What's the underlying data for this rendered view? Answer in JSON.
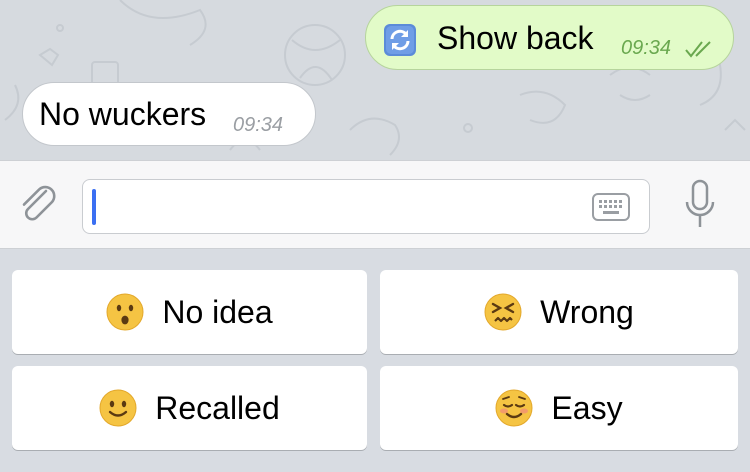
{
  "chat": {
    "messages": [
      {
        "direction": "outgoing",
        "icon": "reload-icon",
        "text": "Show back",
        "time": "09:34",
        "status": "read-double-check"
      },
      {
        "direction": "incoming",
        "text": "No wuckers",
        "time": "09:34"
      }
    ]
  },
  "input_bar": {
    "value": "",
    "placeholder": "",
    "icons": [
      "paperclip-icon",
      "keyboard-icon",
      "microphone-icon"
    ]
  },
  "reply_keyboard": {
    "buttons": [
      {
        "emoji": "hushed-face",
        "label": "No idea"
      },
      {
        "emoji": "confounded-face",
        "label": "Wrong"
      },
      {
        "emoji": "slightly-smiling-face",
        "label": "Recalled"
      },
      {
        "emoji": "relieved-smiling-face",
        "label": "Easy"
      }
    ]
  },
  "colors": {
    "outgoing_bubble": "#e2fbc8",
    "incoming_bubble": "#ffffff",
    "chat_background": "#d6dadf",
    "read_ticks": "#6aa84f",
    "cursor": "#3b6ff2"
  }
}
